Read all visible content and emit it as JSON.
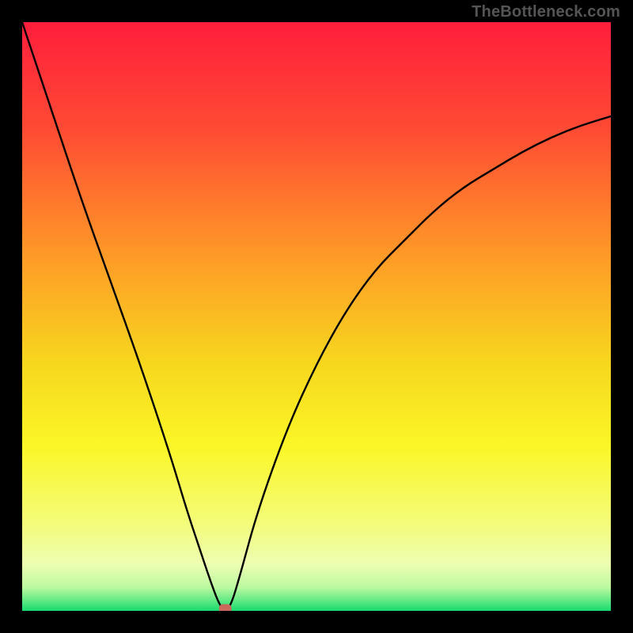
{
  "watermark": "TheBottleneck.com",
  "chart_data": {
    "type": "line",
    "title": "",
    "xlabel": "",
    "ylabel": "",
    "xlim": [
      0,
      100
    ],
    "ylim": [
      0,
      100
    ],
    "grid": false,
    "legend": false,
    "series": [
      {
        "name": "bottleneck-curve",
        "x": [
          0,
          5,
          10,
          15,
          20,
          25,
          28,
          30,
          32,
          33.5,
          34.5,
          35.5,
          37,
          40,
          45,
          50,
          55,
          60,
          65,
          70,
          75,
          80,
          85,
          90,
          95,
          100
        ],
        "y": [
          100,
          85,
          70,
          56,
          42,
          27,
          17,
          11,
          5,
          1,
          0,
          1,
          6,
          17,
          31,
          42,
          51,
          58,
          63,
          68,
          72,
          75,
          78,
          80.5,
          82.5,
          84
        ],
        "color": "#000000"
      }
    ],
    "marker": {
      "name": "optimal-point",
      "x": 34.5,
      "y": 0,
      "color": "#C9685B"
    },
    "gradient_stops": [
      {
        "offset": 0,
        "color": "#FF1E3C"
      },
      {
        "offset": 18,
        "color": "#FF4A34"
      },
      {
        "offset": 40,
        "color": "#FE9B27"
      },
      {
        "offset": 58,
        "color": "#F7D71E"
      },
      {
        "offset": 72,
        "color": "#FBF627"
      },
      {
        "offset": 85,
        "color": "#F4FC79"
      },
      {
        "offset": 92,
        "color": "#EDFEB1"
      },
      {
        "offset": 96,
        "color": "#BDF9A1"
      },
      {
        "offset": 98,
        "color": "#6BEB87"
      },
      {
        "offset": 100,
        "color": "#17DC6F"
      }
    ]
  }
}
